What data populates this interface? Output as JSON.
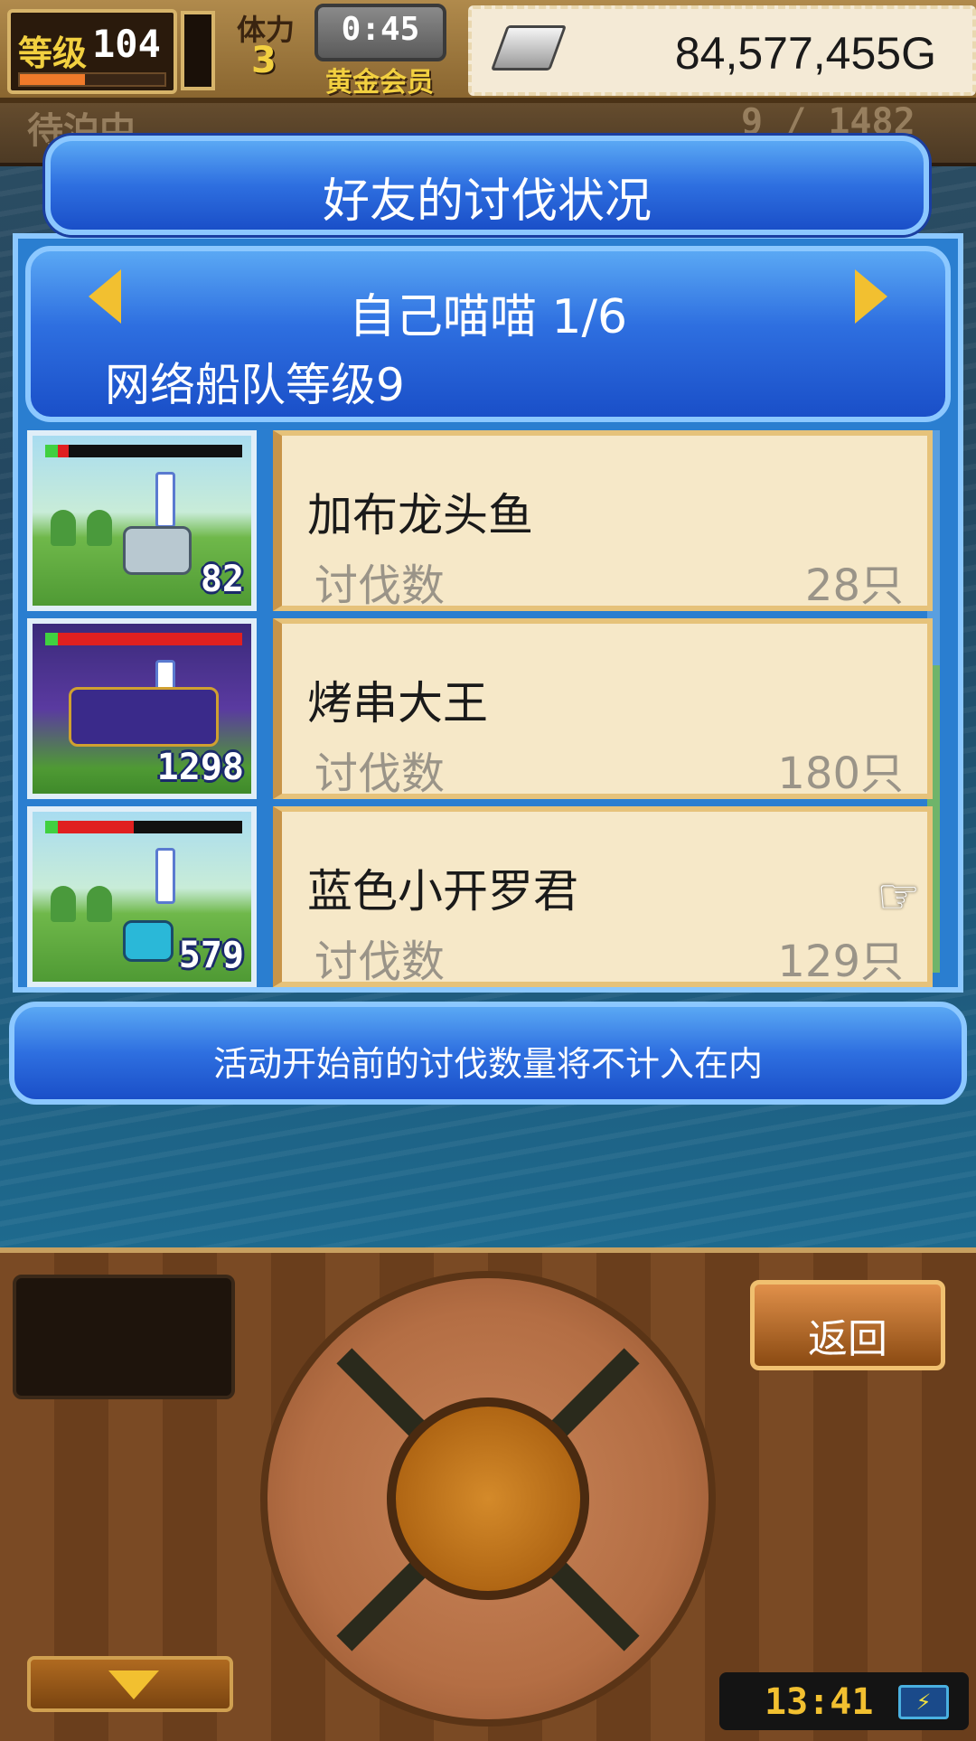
{
  "hud": {
    "level_label": "等级",
    "level_value": "104",
    "exp_fraction": 0.45,
    "stamina_label": "体力",
    "stamina_value": "3",
    "timer": "0:45",
    "membership": "黄金会员",
    "gold": "84,577,455G"
  },
  "background": {
    "ghost_status": "待泊中",
    "ghost_count": "9 / 1482"
  },
  "dialog": {
    "title": "好友的讨伐状况",
    "friend_name": "自己喵喵 1/6",
    "fleet_level": "网络船队等级9",
    "notice": "活动开始前的讨伐数量将不计入在内",
    "rows": [
      {
        "monster_name": "加布龙头鱼",
        "kill_label": "讨伐数",
        "kill_count": "28只",
        "power": "82",
        "hp_fraction": 0.12
      },
      {
        "monster_name": "烤串大王",
        "kill_label": "讨伐数",
        "kill_count": "180只",
        "power": "1298",
        "hp_fraction": 1.0
      },
      {
        "monster_name": "蓝色小开罗君",
        "kill_label": "讨伐数",
        "kill_count": "129只",
        "power": "579",
        "hp_fraction": 0.45
      }
    ]
  },
  "controls": {
    "back_label": "返回",
    "clock": "13:41"
  },
  "colors": {
    "panel_blue": "#2e6fe0",
    "card_bg": "#f6e8c8",
    "accent_gold": "#f2c030"
  }
}
